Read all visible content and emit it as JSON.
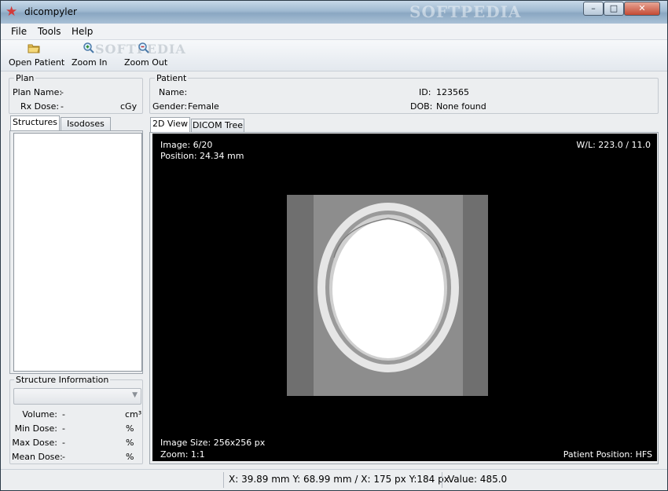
{
  "window": {
    "title": "dicompyler",
    "watermark": "SOFTPEDIA",
    "controls": {
      "minimize": "–",
      "maximize": "□",
      "close": "✕"
    }
  },
  "menu": {
    "items": [
      "File",
      "Tools",
      "Help"
    ]
  },
  "toolbar": {
    "watermark": "SOFTPEDIA",
    "open_patient": {
      "label": "Open Patient",
      "icon": "folder-open-icon"
    },
    "zoom_in": {
      "label": "Zoom In",
      "icon": "zoom-in-icon"
    },
    "zoom_out": {
      "label": "Zoom Out",
      "icon": "zoom-out-icon"
    }
  },
  "plan": {
    "title": "Plan",
    "plan_name_label": "Plan Name:",
    "plan_name_value": "-",
    "rx_dose_label": "Rx Dose:",
    "rx_dose_value": "-",
    "rx_dose_unit": "cGy"
  },
  "patient": {
    "title": "Patient",
    "name_label": "Name:",
    "name_value": "",
    "id_label": "ID:",
    "id_value": "123565",
    "gender_label": "Gender:",
    "gender_value": "Female",
    "dob_label": "DOB:",
    "dob_value": "None found"
  },
  "left_tabs": [
    "Structures",
    "Isodoses"
  ],
  "structure_info": {
    "title": "Structure Information",
    "selected": "",
    "rows": [
      {
        "label": "Volume:",
        "value": "-",
        "unit": "cm³"
      },
      {
        "label": "Min Dose:",
        "value": "-",
        "unit": "%"
      },
      {
        "label": "Max Dose:",
        "value": "-",
        "unit": "%"
      },
      {
        "label": "Mean Dose:",
        "value": "-",
        "unit": "%"
      }
    ]
  },
  "view_tabs": [
    "2D View",
    "DICOM Tree"
  ],
  "viewer": {
    "image": "Image: 6/20",
    "position": "Position: 24.34 mm",
    "wl": "W/L: 223.0 / 11.0",
    "image_size": "Image Size: 256x256 px",
    "zoom": "Zoom: 1:1",
    "patient_position": "Patient Position: HFS"
  },
  "status": {
    "coords": "X: 39.89 mm Y: 68.99 mm / X: 175 px Y:184 px",
    "value": "Value: 485.0"
  }
}
